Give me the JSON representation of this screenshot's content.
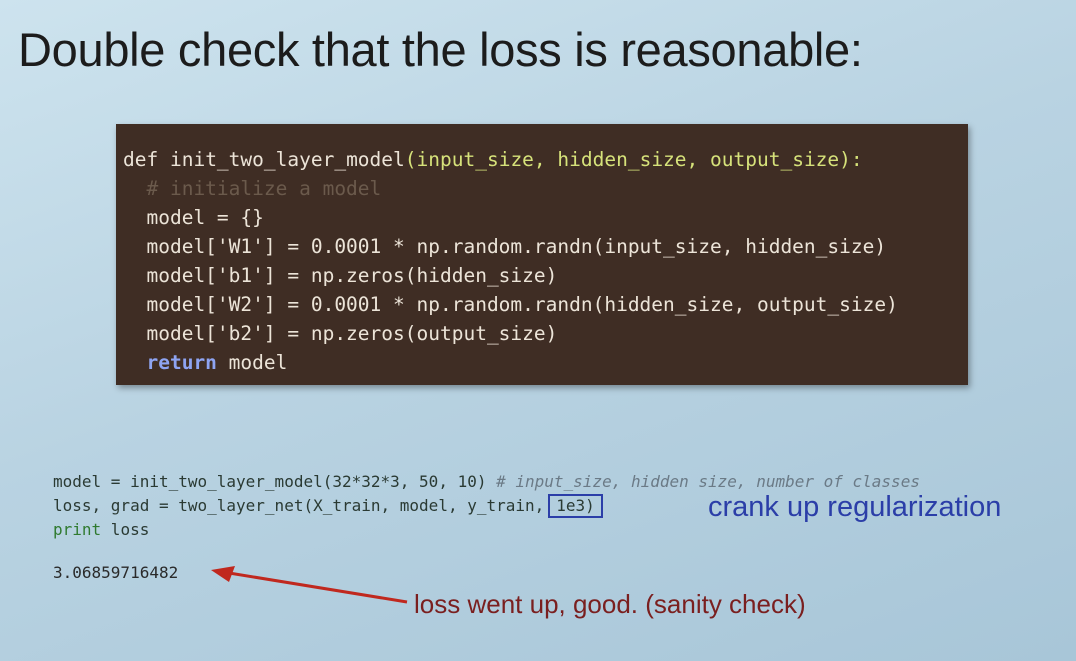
{
  "slide": {
    "title": "Double check that the loss is reasonable:"
  },
  "code_block": {
    "line1_def": "def ",
    "line1_name": "init_two_layer_model",
    "line1_args": "(input_size, hidden_size, output_size):",
    "line2_comment": "  # initialize a model",
    "line3": "  model = {}",
    "line4": "  model['W1'] = 0.0001 * np.random.randn(input_size, hidden_size)",
    "line5": "  model['b1'] = np.zeros(hidden_size)",
    "line6": "  model['W2'] = 0.0001 * np.random.randn(hidden_size, output_size)",
    "line7": "  model['b2'] = np.zeros(output_size)",
    "line8_indent": "  ",
    "line8_kw": "return",
    "line8_rest": " model"
  },
  "lower_code": {
    "line1_code": "model = init_two_layer_model(32*32*3, 50, 10) ",
    "line1_comment": "# input_size, hidden size, number of classes",
    "line2_code": "loss, grad = two_layer_net(X_train, model, y_train,",
    "line2_reg": "1e3)",
    "line3_kw": "print",
    "line3_rest": " loss"
  },
  "output": {
    "loss_value": "3.06859716482"
  },
  "annotations": {
    "blue_note": "crank up regularization",
    "red_note": "loss went up, good. (sanity check)"
  },
  "colors": {
    "code_background": "#3f2d24",
    "annotation_blue": "#2b3ea8",
    "annotation_red": "#7a1f1f",
    "arrow_red": "#c0281e"
  }
}
